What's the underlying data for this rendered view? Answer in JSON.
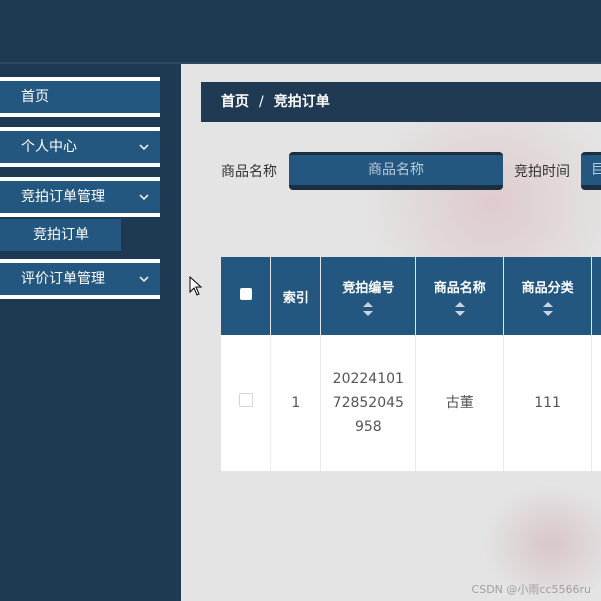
{
  "sidebar": {
    "items": [
      {
        "label": "首页"
      },
      {
        "label": "个人中心"
      },
      {
        "label": "竞拍订单管理"
      },
      {
        "label": "竞拍订单"
      },
      {
        "label": "评价订单管理"
      }
    ]
  },
  "breadcrumb": {
    "home": "首页",
    "separator": "/",
    "current": "竞拍订单"
  },
  "search": {
    "product_name_label": "商品名称",
    "product_name_placeholder": "商品名称",
    "auction_time_label": "竞拍时间",
    "auction_time_value": "目"
  },
  "table": {
    "headers": [
      "索引",
      "竞拍编号",
      "商品名称",
      "商品分类"
    ],
    "rows": [
      {
        "index": "1",
        "auction_no": "2022410172852045958",
        "product_name": "古董",
        "category": "111"
      }
    ]
  },
  "watermark": "CSDN @小雨cc5566ru"
}
